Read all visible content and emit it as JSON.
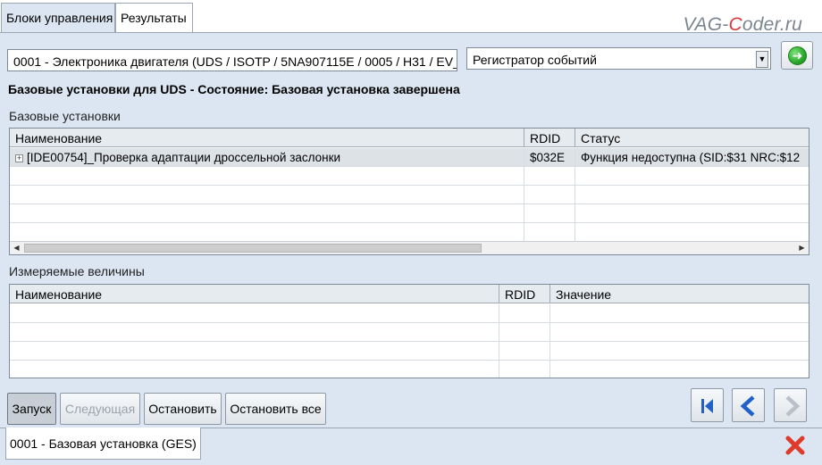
{
  "tabs": [
    {
      "label": "Блоки управления",
      "active": true
    },
    {
      "label": "Результаты",
      "active": false
    }
  ],
  "watermark": {
    "part1": "VAG-",
    "part2": "C",
    "part3": "oder.ru"
  },
  "module_combo": {
    "value": "0001 - Электроника двигателя  (UDS / ISOTP / 5NA907115E / 0005 / H31 / EV_"
  },
  "mode_combo": {
    "value": "Регистратор событий"
  },
  "heading": "Базовые установки для UDS - Состояние: Базовая установка завершена",
  "basic_settings": {
    "label": "Базовые установки",
    "columns": [
      "Наименование",
      "RDID",
      "Статус"
    ],
    "rows": [
      {
        "name": "[IDE00754]_Проверка адаптации дроссельной заслонки",
        "rdid": "$032E",
        "status": "Функция недоступна (SID:$31 NRC:$12"
      }
    ]
  },
  "measured_values": {
    "label": "Измеряемые величины",
    "columns": [
      "Наименование",
      "RDID",
      "Значение"
    ]
  },
  "buttons": {
    "start": "Запуск",
    "next": "Следующая",
    "stop": "Остановить",
    "stop_all": "Остановить все"
  },
  "bottom_tab": {
    "label": "0001 - Базовая установка (GES)"
  },
  "icons": {
    "go": "arrow-right-circle-icon",
    "first": "skip-first-icon",
    "prev": "chevron-left-icon",
    "next": "chevron-right-icon",
    "close": "close-icon"
  },
  "colors": {
    "background": "#dbe6f2",
    "accent_blue": "#2060c8",
    "close_red": "#e03a2a",
    "go_green": "#2aa82a"
  }
}
